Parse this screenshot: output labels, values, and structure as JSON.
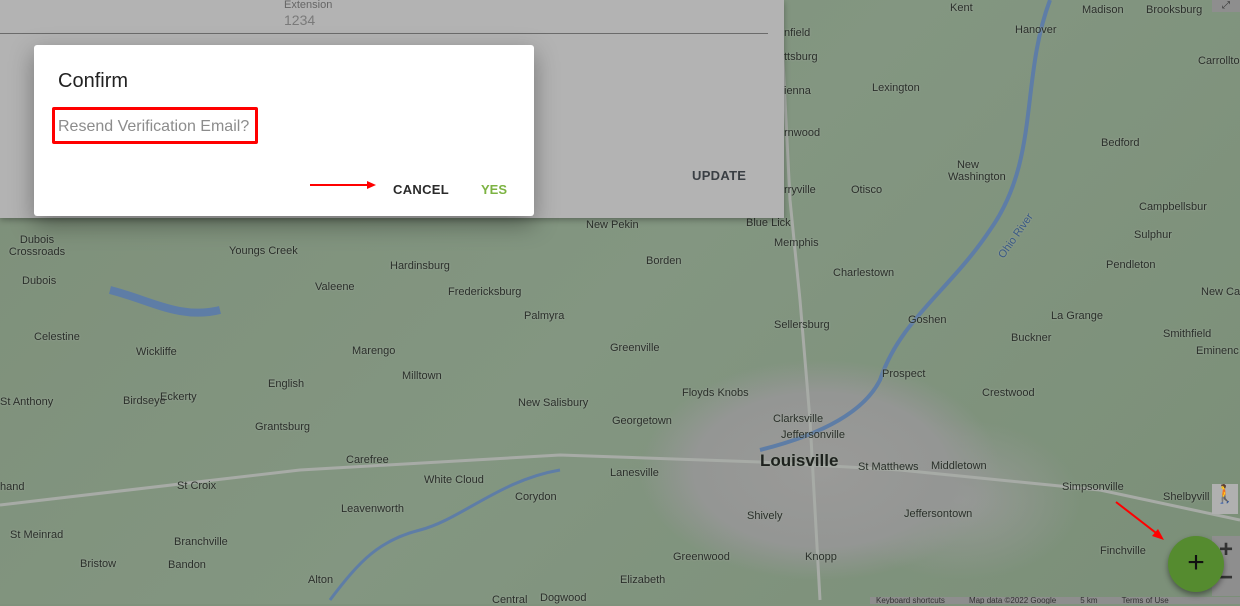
{
  "panel": {
    "extension_label": "Extension",
    "extension_value": "1234",
    "update_label": "UPDATE"
  },
  "dialog": {
    "title": "Confirm",
    "message": "Resend Verification Email?",
    "cancel_label": "CANCEL",
    "yes_label": "YES",
    "yes_color": "#7cb342"
  },
  "fab": {
    "icon": "plus-icon",
    "label": "+",
    "color": "#558b2f"
  },
  "map": {
    "labels": [
      "Kent",
      "Hanover",
      "Madison",
      "Brooksburg",
      "Carrollto",
      "Lexington",
      "Bedford",
      "New Washington",
      "Otisco",
      "Blue Lick",
      "Memphis",
      "Charlestown",
      "Campbellsbur",
      "Sulphur",
      "Pendleton",
      "New Ca",
      "La Grange",
      "Goshen",
      "Sellersburg",
      "Buckner",
      "Smithfield",
      "Eminenc",
      "Prospect",
      "Crestwood",
      "Floyds Knobs",
      "Clarksville",
      "Jeffersonville",
      "Louisville",
      "St Matthews",
      "Middletown",
      "Simpsonville",
      "Shelbyvill",
      "Jeffersontown",
      "Shively",
      "Finchville",
      "Greenwood",
      "Knopp",
      "Elizabeth",
      "Georgetown",
      "Greenville",
      "Lanesville",
      "New Salisbury",
      "Corydon",
      "Palmyra",
      "Fredericksburg",
      "Borden",
      "New Pekin",
      "Hardinsburg",
      "Valeene",
      "Youngs Creek",
      "Dubois Crossroads",
      "Dubois",
      "Celestine",
      "Wickliffe",
      "Marengo",
      "English",
      "Milltown",
      "Birdseye",
      "Eckerty",
      "St Anthony",
      "Grantsburg",
      "Carefree",
      "White Cloud",
      "St Croix",
      "Leavenworth",
      "Branchville",
      "St Meinrad",
      "Bristow",
      "Bandon",
      "Alton",
      "Central",
      "Dogwood",
      "Ohio River",
      "rnwood",
      "rryville",
      "nfield",
      "ttsburg",
      "ienna",
      "hand"
    ],
    "footer": [
      "Keyboard shortcuts",
      "Map data ©2022 Google",
      "5 km",
      "Terms of Use"
    ],
    "zoom_in": "+",
    "zoom_out": "−"
  }
}
